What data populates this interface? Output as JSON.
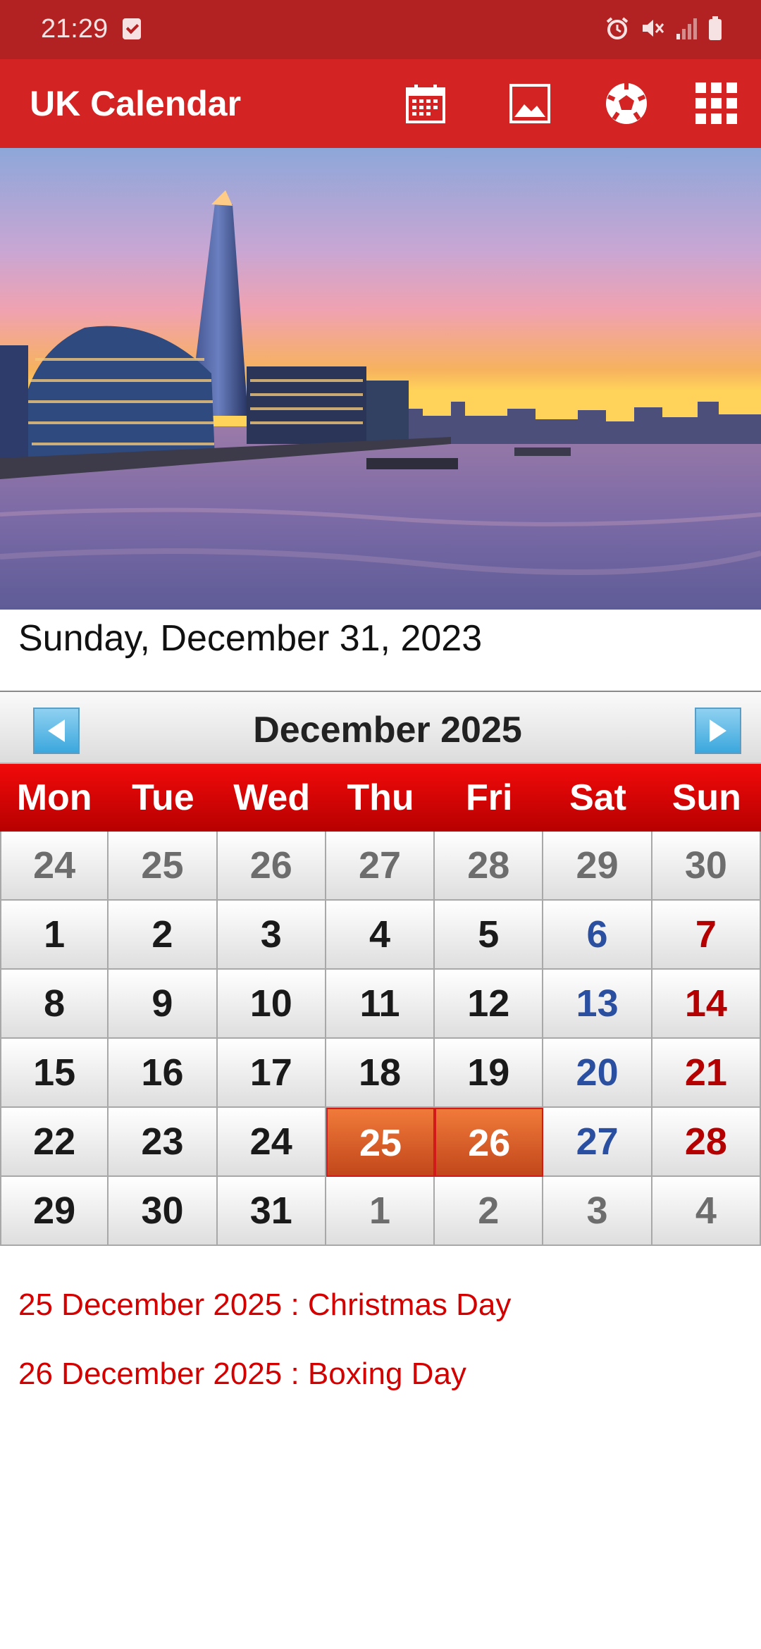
{
  "status_bar": {
    "time": "21:29",
    "icons": [
      "notification-check-icon",
      "alarm-icon",
      "mute-icon",
      "signal-icon",
      "battery-icon"
    ]
  },
  "app_bar": {
    "title": "UK Calendar",
    "actions": [
      "calendar-icon",
      "image-icon",
      "football-icon",
      "grid-apps-icon"
    ]
  },
  "hero_image": "London skyline at sunset (City Hall, The Shard, River Thames)",
  "current_date": "Sunday, December 31, 2023",
  "calendar": {
    "month_title": "December  2025",
    "weekdays": [
      "Mon",
      "Tue",
      "Wed",
      "Thu",
      "Fri",
      "Sat",
      "Sun"
    ],
    "weeks": [
      [
        "24",
        "25",
        "26",
        "27",
        "28",
        "29",
        "30"
      ],
      [
        "1",
        "2",
        "3",
        "4",
        "5",
        "6",
        "7"
      ],
      [
        "8",
        "9",
        "10",
        "11",
        "12",
        "13",
        "14"
      ],
      [
        "15",
        "16",
        "17",
        "18",
        "19",
        "20",
        "21"
      ],
      [
        "22",
        "23",
        "24",
        "25",
        "26",
        "27",
        "28"
      ],
      [
        "29",
        "30",
        "31",
        "1",
        "2",
        "3",
        "4"
      ]
    ],
    "holidays_highlighted": [
      "25",
      "26"
    ]
  },
  "holidays": [
    "25 December 2025 : Christmas Day",
    "26 December 2025 : Boxing Day"
  ],
  "colors": {
    "status_bar": "#b22222",
    "app_bar": "#d32323",
    "weekday_header": "#d00000",
    "holiday_cell": "#dc5a28",
    "saturday": "#2b4fa0",
    "sunday": "#b40000",
    "holiday_text": "#d40000"
  }
}
